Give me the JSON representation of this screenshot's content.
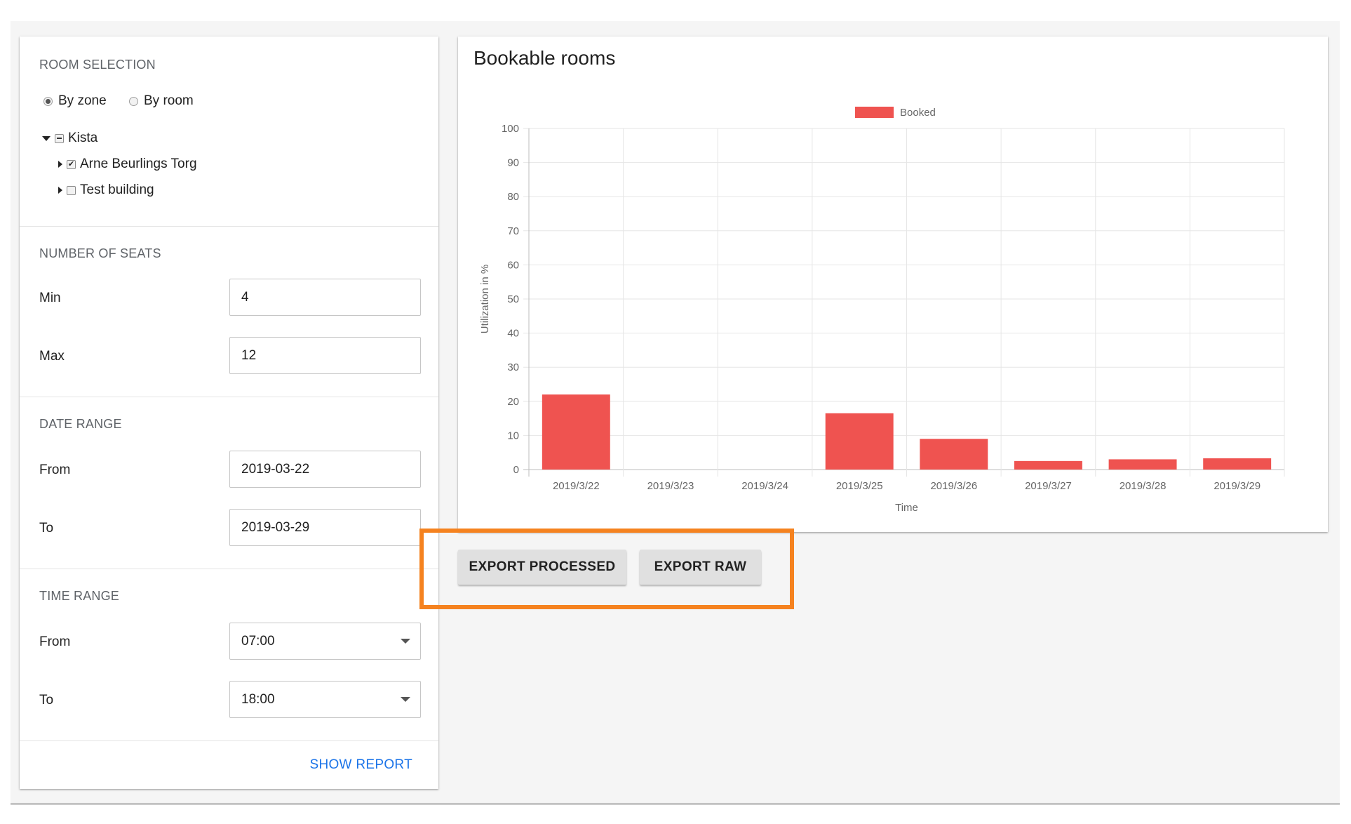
{
  "room_selection": {
    "title": "ROOM SELECTION",
    "modes": [
      {
        "label": "By zone",
        "selected": true
      },
      {
        "label": "By room",
        "selected": false
      }
    ],
    "tree": {
      "label": "Kista",
      "state": "indeterminate",
      "children": [
        {
          "label": "Arne Beurlings Torg",
          "checked": true
        },
        {
          "label": "Test building",
          "checked": false
        }
      ]
    }
  },
  "seats": {
    "title": "NUMBER OF SEATS",
    "min_label": "Min",
    "min_value": "4",
    "max_label": "Max",
    "max_value": "12"
  },
  "date_range": {
    "title": "DATE RANGE",
    "from_label": "From",
    "from_value": "2019-03-22",
    "to_label": "To",
    "to_value": "2019-03-29"
  },
  "time_range": {
    "title": "TIME RANGE",
    "from_label": "From",
    "from_value": "07:00",
    "to_label": "To",
    "to_value": "18:00"
  },
  "show_report_label": "SHOW REPORT",
  "chart_card": {
    "title": "Bookable rooms"
  },
  "buttons": {
    "export_processed": "EXPORT PROCESSED",
    "export_raw": "EXPORT RAW"
  },
  "colors": {
    "bar": "#ef5350",
    "highlight": "#f5821f",
    "link": "#1a73e8"
  },
  "chart_data": {
    "type": "bar",
    "title": "",
    "xlabel": "Time",
    "ylabel": "Utilization in %",
    "ylim": [
      0,
      100
    ],
    "yticks": [
      0,
      10,
      20,
      30,
      40,
      50,
      60,
      70,
      80,
      90,
      100
    ],
    "legend_position": "top",
    "grid": true,
    "categories": [
      "2019/3/22",
      "2019/3/23",
      "2019/3/24",
      "2019/3/25",
      "2019/3/26",
      "2019/3/27",
      "2019/3/28",
      "2019/3/29"
    ],
    "series": [
      {
        "name": "Booked",
        "color": "#ef5350",
        "values": [
          22,
          0,
          0,
          16.5,
          9,
          2.5,
          3,
          3.3
        ]
      }
    ]
  }
}
